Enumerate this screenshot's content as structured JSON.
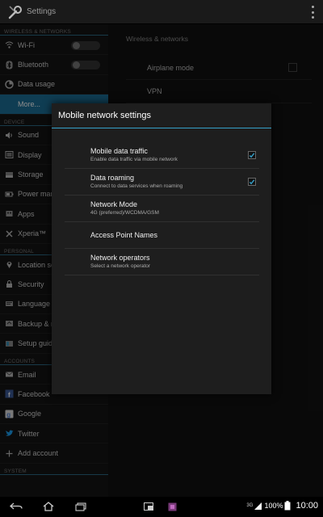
{
  "actionbar": {
    "title": "Settings"
  },
  "sidebar": {
    "sections": [
      {
        "label": "WIRELESS & NETWORKS"
      },
      {
        "label": "DEVICE"
      },
      {
        "label": "PERSONAL"
      },
      {
        "label": "ACCOUNTS"
      },
      {
        "label": "SYSTEM"
      }
    ],
    "items": [
      {
        "label": "Wi-Fi",
        "icon": "wifi-icon"
      },
      {
        "label": "Bluetooth",
        "icon": "bluetooth-icon"
      },
      {
        "label": "Data usage",
        "icon": "data-usage-icon"
      },
      {
        "label": "More...",
        "icon": ""
      },
      {
        "label": "Sound",
        "icon": "sound-icon"
      },
      {
        "label": "Display",
        "icon": "display-icon"
      },
      {
        "label": "Storage",
        "icon": "storage-icon"
      },
      {
        "label": "Power mar",
        "icon": "power-icon"
      },
      {
        "label": "Apps",
        "icon": "apps-icon"
      },
      {
        "label": "Xperia™",
        "icon": "xperia-icon"
      },
      {
        "label": "Location se",
        "icon": "location-icon"
      },
      {
        "label": "Security",
        "icon": "lock-icon"
      },
      {
        "label": "Language &",
        "icon": "language-icon"
      },
      {
        "label": "Backup & r",
        "icon": "backup-icon"
      },
      {
        "label": "Setup guid",
        "icon": "setup-icon"
      },
      {
        "label": "Email",
        "icon": "email-icon"
      },
      {
        "label": "Facebook",
        "icon": "facebook-icon"
      },
      {
        "label": "Google",
        "icon": "google-icon"
      },
      {
        "label": "Twitter",
        "icon": "twitter-icon"
      },
      {
        "label": "Add account",
        "icon": "plus-icon"
      }
    ]
  },
  "rightpane": {
    "header": "Wireless & networks",
    "rows": [
      {
        "label": "Airplane mode"
      },
      {
        "label": "VPN"
      }
    ]
  },
  "dialog": {
    "title": "Mobile network settings",
    "rows": [
      {
        "title": "Mobile data traffic",
        "subtitle": "Enable data traffic via mobile network",
        "checked": true
      },
      {
        "title": "Data roaming",
        "subtitle": "Connect to data services when roaming",
        "checked": true
      },
      {
        "title": "Network Mode",
        "subtitle": "4G (preferred)/WCDMA/GSM"
      },
      {
        "title": "Access Point Names",
        "subtitle": ""
      },
      {
        "title": "Network operators",
        "subtitle": "Select a network operator"
      }
    ]
  },
  "statusbar": {
    "network": "3G",
    "battery": "100%",
    "time": "10:00"
  },
  "colors": {
    "accent": "#35a0c9",
    "selected": "#1c6f97",
    "facebook": "#3b5998",
    "twitter": "#1da1f2"
  }
}
